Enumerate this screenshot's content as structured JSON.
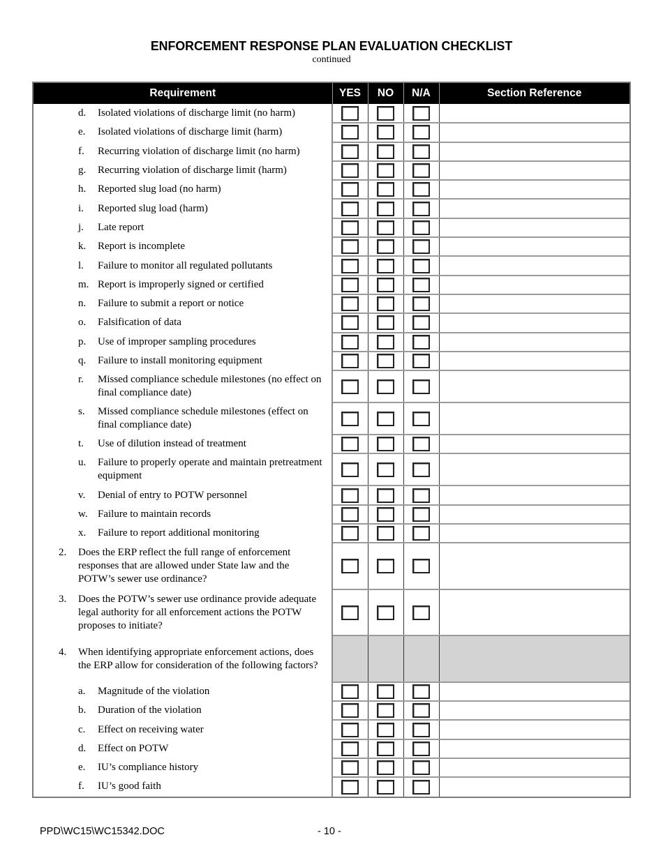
{
  "document": {
    "title": "ENFORCEMENT RESPONSE PLAN EVALUATION CHECKLIST",
    "subtitle": "continued"
  },
  "table": {
    "headers": {
      "requirement": "Requirement",
      "yes": "YES",
      "no": "NO",
      "na": "N/A",
      "section_reference": "Section Reference"
    },
    "rows": [
      {
        "label": "d.",
        "text": "Isolated violations of discharge limit (no harm)",
        "level": "sub",
        "lines": 1,
        "checkboxes": true,
        "section_reference": ""
      },
      {
        "label": "e.",
        "text": "Isolated violations of discharge limit (harm)",
        "level": "sub",
        "lines": 1,
        "checkboxes": true,
        "section_reference": ""
      },
      {
        "label": "f.",
        "text": "Recurring violation of discharge limit (no harm)",
        "level": "sub",
        "lines": 1,
        "checkboxes": true,
        "section_reference": ""
      },
      {
        "label": "g.",
        "text": "Recurring violation of discharge limit (harm)",
        "level": "sub",
        "lines": 1,
        "checkboxes": true,
        "section_reference": ""
      },
      {
        "label": "h.",
        "text": "Reported slug load (no harm)",
        "level": "sub",
        "lines": 1,
        "checkboxes": true,
        "section_reference": ""
      },
      {
        "label": "i.",
        "text": "Reported slug load (harm)",
        "level": "sub",
        "lines": 1,
        "checkboxes": true,
        "section_reference": ""
      },
      {
        "label": "j.",
        "text": "Late report",
        "level": "sub",
        "lines": 1,
        "checkboxes": true,
        "section_reference": ""
      },
      {
        "label": "k.",
        "text": "Report is incomplete",
        "level": "sub",
        "lines": 1,
        "checkboxes": true,
        "section_reference": ""
      },
      {
        "label": "l.",
        "text": "Failure to monitor all regulated pollutants",
        "level": "sub",
        "lines": 1,
        "checkboxes": true,
        "section_reference": ""
      },
      {
        "label": "m.",
        "text": "Report is improperly signed or certified",
        "level": "sub",
        "lines": 1,
        "checkboxes": true,
        "section_reference": ""
      },
      {
        "label": "n.",
        "text": "Failure to submit a report or notice",
        "level": "sub",
        "lines": 1,
        "checkboxes": true,
        "section_reference": ""
      },
      {
        "label": "o.",
        "text": "Falsification of data",
        "level": "sub",
        "lines": 1,
        "checkboxes": true,
        "section_reference": ""
      },
      {
        "label": "p.",
        "text": "Use of improper sampling procedures",
        "level": "sub",
        "lines": 1,
        "checkboxes": true,
        "section_reference": ""
      },
      {
        "label": "q.",
        "text": "Failure to install monitoring equipment",
        "level": "sub",
        "lines": 1,
        "checkboxes": true,
        "section_reference": ""
      },
      {
        "label": "r.",
        "text": "Missed compliance schedule milestones (no effect on final compliance date)",
        "level": "sub",
        "lines": 2,
        "checkboxes": true,
        "section_reference": ""
      },
      {
        "label": "s.",
        "text": "Missed compliance schedule milestones (effect on final compliance date)",
        "level": "sub",
        "lines": 2,
        "checkboxes": true,
        "section_reference": ""
      },
      {
        "label": "t.",
        "text": "Use of dilution instead of treatment",
        "level": "sub",
        "lines": 1,
        "checkboxes": true,
        "section_reference": ""
      },
      {
        "label": "u.",
        "text": "Failure to properly operate and maintain pretreatment equipment",
        "level": "sub",
        "lines": 2,
        "checkboxes": true,
        "section_reference": ""
      },
      {
        "label": "v.",
        "text": "Denial of entry to POTW personnel",
        "level": "sub",
        "lines": 1,
        "checkboxes": true,
        "section_reference": ""
      },
      {
        "label": "w.",
        "text": "Failure to maintain records",
        "level": "sub",
        "lines": 1,
        "checkboxes": true,
        "section_reference": ""
      },
      {
        "label": "x.",
        "text": "Failure to report additional monitoring",
        "level": "sub",
        "lines": 1,
        "checkboxes": true,
        "section_reference": ""
      },
      {
        "label": "2.",
        "text": "Does the ERP reflect the full range of enforcement responses that are allowed under State law and the POTW’s sewer use ordinance?",
        "level": "main",
        "lines": 3,
        "checkboxes": true,
        "section_reference": ""
      },
      {
        "label": "3.",
        "text": "Does the POTW’s sewer use ordinance provide adequate legal authority for all enforcement actions the POTW proposes to initiate?",
        "level": "main",
        "lines": 3,
        "checkboxes": true,
        "section_reference": ""
      },
      {
        "label": "4.",
        "text": "When identifying appropriate enforcement actions, does the ERP allow for consideration of the following factors?",
        "level": "main",
        "lines": 3,
        "checkboxes": false,
        "section_reference": ""
      },
      {
        "label": "a.",
        "text": "Magnitude of the violation",
        "level": "sub",
        "lines": 1,
        "checkboxes": true,
        "section_reference": ""
      },
      {
        "label": "b.",
        "text": "Duration of the violation",
        "level": "sub",
        "lines": 1,
        "checkboxes": true,
        "section_reference": ""
      },
      {
        "label": "c.",
        "text": "Effect on receiving water",
        "level": "sub",
        "lines": 1,
        "checkboxes": true,
        "section_reference": ""
      },
      {
        "label": "d.",
        "text": "Effect on POTW",
        "level": "sub",
        "lines": 1,
        "checkboxes": true,
        "section_reference": ""
      },
      {
        "label": "e.",
        "text": "IU’s compliance history",
        "level": "sub",
        "lines": 1,
        "checkboxes": true,
        "section_reference": ""
      },
      {
        "label": "f.",
        "text": "IU’s good faith",
        "level": "sub",
        "lines": 1,
        "checkboxes": true,
        "section_reference": ""
      }
    ]
  },
  "footer": {
    "file_path": "PPD\\WC15\\WC15342.DOC",
    "page_number": "- 10 -"
  }
}
